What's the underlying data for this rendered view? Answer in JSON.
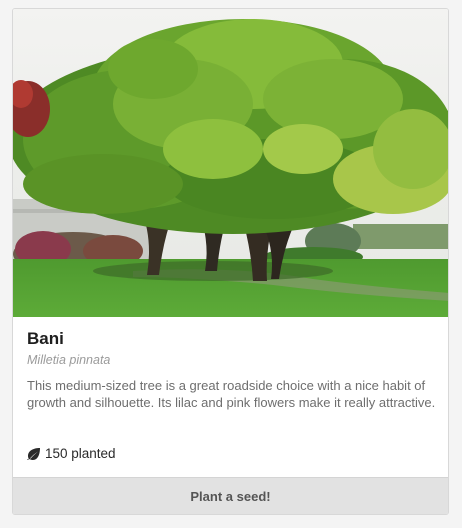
{
  "card": {
    "image_alt": "Bani tree",
    "title": "Bani",
    "scientific_name": "Milletia pinnata",
    "description": "This medium-sized tree is a great roadside choice with a nice habit of growth and silhouette. Its lilac and pink flowers make it really attractive.",
    "planted_icon": "leaf-icon",
    "planted_text": "150 planted",
    "button_label": "Plant a seed!"
  },
  "colors": {
    "button_bg": "#e2e2e2",
    "title": "#1e1e1e",
    "muted": "#9a9a9a"
  }
}
